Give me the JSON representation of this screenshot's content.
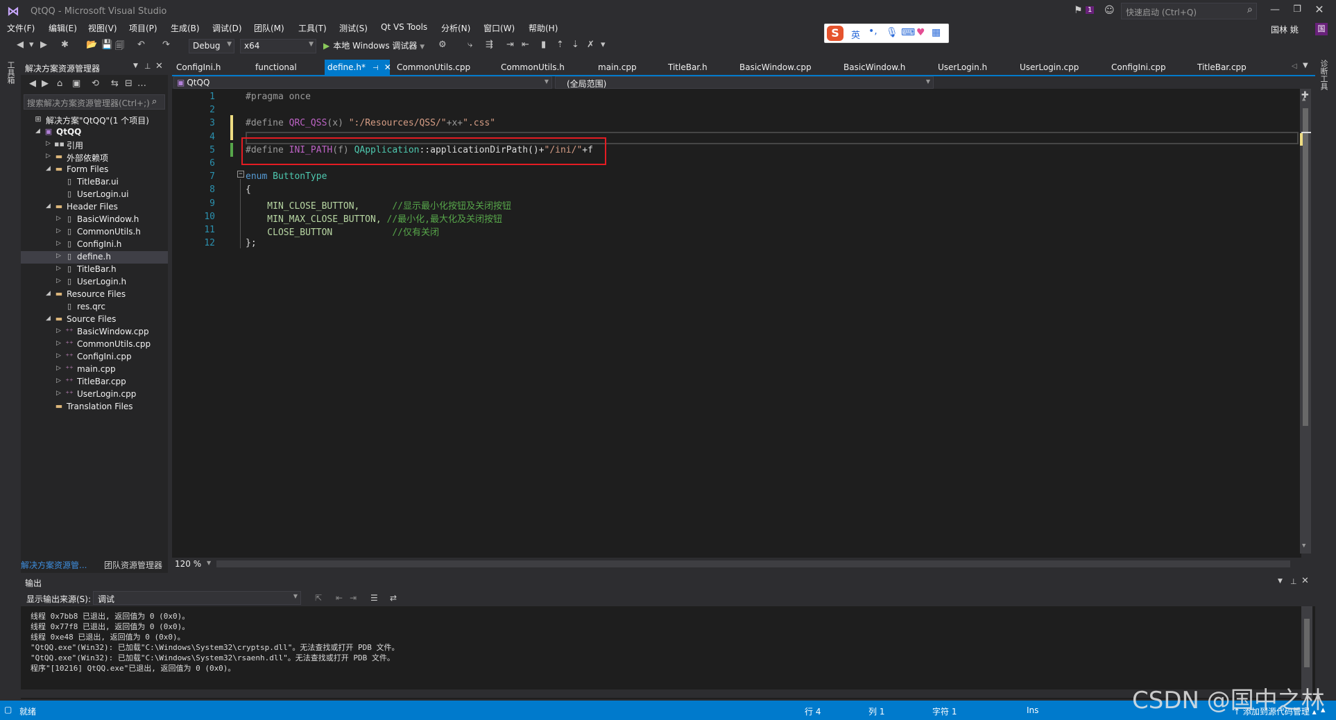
{
  "window": {
    "title": "QtQQ - Microsoft Visual Studio",
    "notification_count": "1",
    "quick_launch_placeholder": "快速启动 (Ctrl+Q)",
    "user_name": "国林 姚",
    "user_initial": "国"
  },
  "menu": [
    "文件(F)",
    "编辑(E)",
    "视图(V)",
    "项目(P)",
    "生成(B)",
    "调试(D)",
    "团队(M)",
    "工具(T)",
    "测试(S)",
    "Qt VS Tools",
    "分析(N)",
    "窗口(W)",
    "帮助(H)"
  ],
  "ime": {
    "mode": "英",
    "punct": "•,",
    "logo": "S"
  },
  "toolbar": {
    "config": "Debug",
    "platform": "x64",
    "start_debug": "本地 Windows 调试器"
  },
  "side_tabs": {
    "left": "工具箱",
    "right": "诊断工具"
  },
  "solution_explorer": {
    "title": "解决方案资源管理器",
    "search_placeholder": "搜索解决方案资源管理器(Ctrl+;)",
    "tree": [
      {
        "label": "解决方案\"QtQQ\"(1 个项目)",
        "level": 0,
        "icon": "solution-icon",
        "expander": ""
      },
      {
        "label": "QtQQ",
        "level": 1,
        "icon": "project-icon",
        "expander": "◢",
        "bold": true
      },
      {
        "label": "引用",
        "level": 2,
        "icon": "references-icon",
        "expander": "▷"
      },
      {
        "label": "外部依赖项",
        "level": 2,
        "icon": "folder-icon",
        "expander": "▷"
      },
      {
        "label": "Form Files",
        "level": 2,
        "icon": "folder-icon",
        "expander": "◢"
      },
      {
        "label": "TitleBar.ui",
        "level": 3,
        "icon": "file-icon",
        "expander": ""
      },
      {
        "label": "UserLogin.ui",
        "level": 3,
        "icon": "file-icon",
        "expander": ""
      },
      {
        "label": "Header Files",
        "level": 2,
        "icon": "folder-icon",
        "expander": "◢"
      },
      {
        "label": "BasicWindow.h",
        "level": 3,
        "icon": "header-file-icon",
        "expander": "▷"
      },
      {
        "label": "CommonUtils.h",
        "level": 3,
        "icon": "header-file-icon",
        "expander": "▷"
      },
      {
        "label": "ConfigIni.h",
        "level": 3,
        "icon": "header-file-icon",
        "expander": "▷"
      },
      {
        "label": "define.h",
        "level": 3,
        "icon": "header-file-icon",
        "expander": "▷",
        "selected": true
      },
      {
        "label": "TitleBar.h",
        "level": 3,
        "icon": "header-file-icon",
        "expander": "▷"
      },
      {
        "label": "UserLogin.h",
        "level": 3,
        "icon": "header-file-icon",
        "expander": "▷"
      },
      {
        "label": "Resource Files",
        "level": 2,
        "icon": "folder-icon",
        "expander": "◢"
      },
      {
        "label": "res.qrc",
        "level": 3,
        "icon": "file-icon",
        "expander": ""
      },
      {
        "label": "Source Files",
        "level": 2,
        "icon": "folder-icon",
        "expander": "◢"
      },
      {
        "label": "BasicWindow.cpp",
        "level": 3,
        "icon": "cpp-file-icon",
        "expander": "▷"
      },
      {
        "label": "CommonUtils.cpp",
        "level": 3,
        "icon": "cpp-file-icon",
        "expander": "▷"
      },
      {
        "label": "ConfigIni.cpp",
        "level": 3,
        "icon": "cpp-file-icon",
        "expander": "▷"
      },
      {
        "label": "main.cpp",
        "level": 3,
        "icon": "cpp-file-icon",
        "expander": "▷"
      },
      {
        "label": "TitleBar.cpp",
        "level": 3,
        "icon": "cpp-file-icon",
        "expander": "▷"
      },
      {
        "label": "UserLogin.cpp",
        "level": 3,
        "icon": "cpp-file-icon",
        "expander": "▷"
      },
      {
        "label": "Translation Files",
        "level": 2,
        "icon": "folder-icon",
        "expander": ""
      }
    ],
    "bottom_tabs": {
      "solution": "解决方案资源管...",
      "team": "团队资源管理器"
    }
  },
  "doc_tabs": [
    {
      "label": "ConfigIni.h"
    },
    {
      "label": "functional"
    },
    {
      "label": "define.h*",
      "active": true
    },
    {
      "label": "CommonUtils.cpp"
    },
    {
      "label": "CommonUtils.h"
    },
    {
      "label": "main.cpp"
    },
    {
      "label": "TitleBar.h"
    },
    {
      "label": "BasicWindow.cpp"
    },
    {
      "label": "BasicWindow.h"
    },
    {
      "label": "UserLogin.h"
    },
    {
      "label": "UserLogin.cpp"
    },
    {
      "label": "ConfigIni.cpp"
    },
    {
      "label": "TitleBar.cpp"
    }
  ],
  "navbar": {
    "project": "QtQQ",
    "scope": "(全局范围)"
  },
  "editor": {
    "zoom": "120 %",
    "lines": [
      {
        "no": "1",
        "tokens": [
          {
            "t": "#pragma once",
            "c": "c-pre"
          }
        ]
      },
      {
        "no": "2",
        "tokens": []
      },
      {
        "no": "3",
        "tokens": [
          {
            "t": "#define ",
            "c": "c-pre"
          },
          {
            "t": "QRC_QSS",
            "c": "c-macro"
          },
          {
            "t": "(x) ",
            "c": "c-pre"
          },
          {
            "t": "\":/Resources/QSS/\"",
            "c": "c-str"
          },
          {
            "t": "+x+",
            "c": "c-pre"
          },
          {
            "t": "\".css\"",
            "c": "c-str"
          }
        ]
      },
      {
        "no": "4",
        "tokens": []
      },
      {
        "no": "5",
        "tokens": [
          {
            "t": "#define ",
            "c": "c-pre"
          },
          {
            "t": "INI_PATH",
            "c": "c-macro"
          },
          {
            "t": "(f) ",
            "c": "c-pre"
          },
          {
            "t": "QApplication",
            "c": "c-type"
          },
          {
            "t": "::applicationDirPath()+",
            "c": "c-plain"
          },
          {
            "t": "\"/ini/\"",
            "c": "c-str"
          },
          {
            "t": "+f",
            "c": "c-plain"
          }
        ]
      },
      {
        "no": "6",
        "tokens": []
      },
      {
        "no": "7",
        "tokens": [
          {
            "t": "enum ",
            "c": "c-kw"
          },
          {
            "t": "ButtonType",
            "c": "c-type"
          }
        ]
      },
      {
        "no": "8",
        "tokens": [
          {
            "t": "{",
            "c": "c-plain"
          }
        ]
      },
      {
        "no": "9",
        "tokens": [
          {
            "t": "    MIN_CLOSE_BUTTON,      ",
            "c": "c-const"
          },
          {
            "t": "//显示最小化按钮及关闭按钮",
            "c": "c-cmt"
          }
        ]
      },
      {
        "no": "10",
        "tokens": [
          {
            "t": "    MIN_MAX_CLOSE_BUTTON, ",
            "c": "c-const"
          },
          {
            "t": "//最小化,最大化及关闭按钮",
            "c": "c-cmt"
          }
        ]
      },
      {
        "no": "11",
        "tokens": [
          {
            "t": "    CLOSE_BUTTON           ",
            "c": "c-const"
          },
          {
            "t": "//仅有关闭",
            "c": "c-cmt"
          }
        ]
      },
      {
        "no": "12",
        "tokens": [
          {
            "t": "};",
            "c": "c-plain"
          }
        ]
      }
    ]
  },
  "output": {
    "title": "输出",
    "source_label": "显示输出来源(S):",
    "source_value": "调试",
    "lines": [
      "线程 0x7bb8 已退出, 返回值为 0 (0x0)。",
      "线程 0x77f8 已退出, 返回值为 0 (0x0)。",
      "线程 0xe48 已退出, 返回值为 0 (0x0)。",
      "\"QtQQ.exe\"(Win32): 已加载\"C:\\Windows\\System32\\cryptsp.dll\"。无法查找或打开 PDB 文件。",
      "\"QtQQ.exe\"(Win32): 已加载\"C:\\Windows\\System32\\rsaenh.dll\"。无法查找或打开 PDB 文件。",
      "程序\"[10216] QtQQ.exe\"已退出, 返回值为 0 (0x0)。"
    ]
  },
  "statusbar": {
    "ready": "就绪",
    "line": "行 4",
    "col": "列 1",
    "ch": "字符 1",
    "ins": "Ins",
    "source_control": "↑ 添加到源代码管理 ▴"
  },
  "watermark": "CSDN @国中之林",
  "colors": {
    "accent": "#007acc",
    "highlight_box": "#e51c23",
    "background": "#1e1e1e"
  }
}
